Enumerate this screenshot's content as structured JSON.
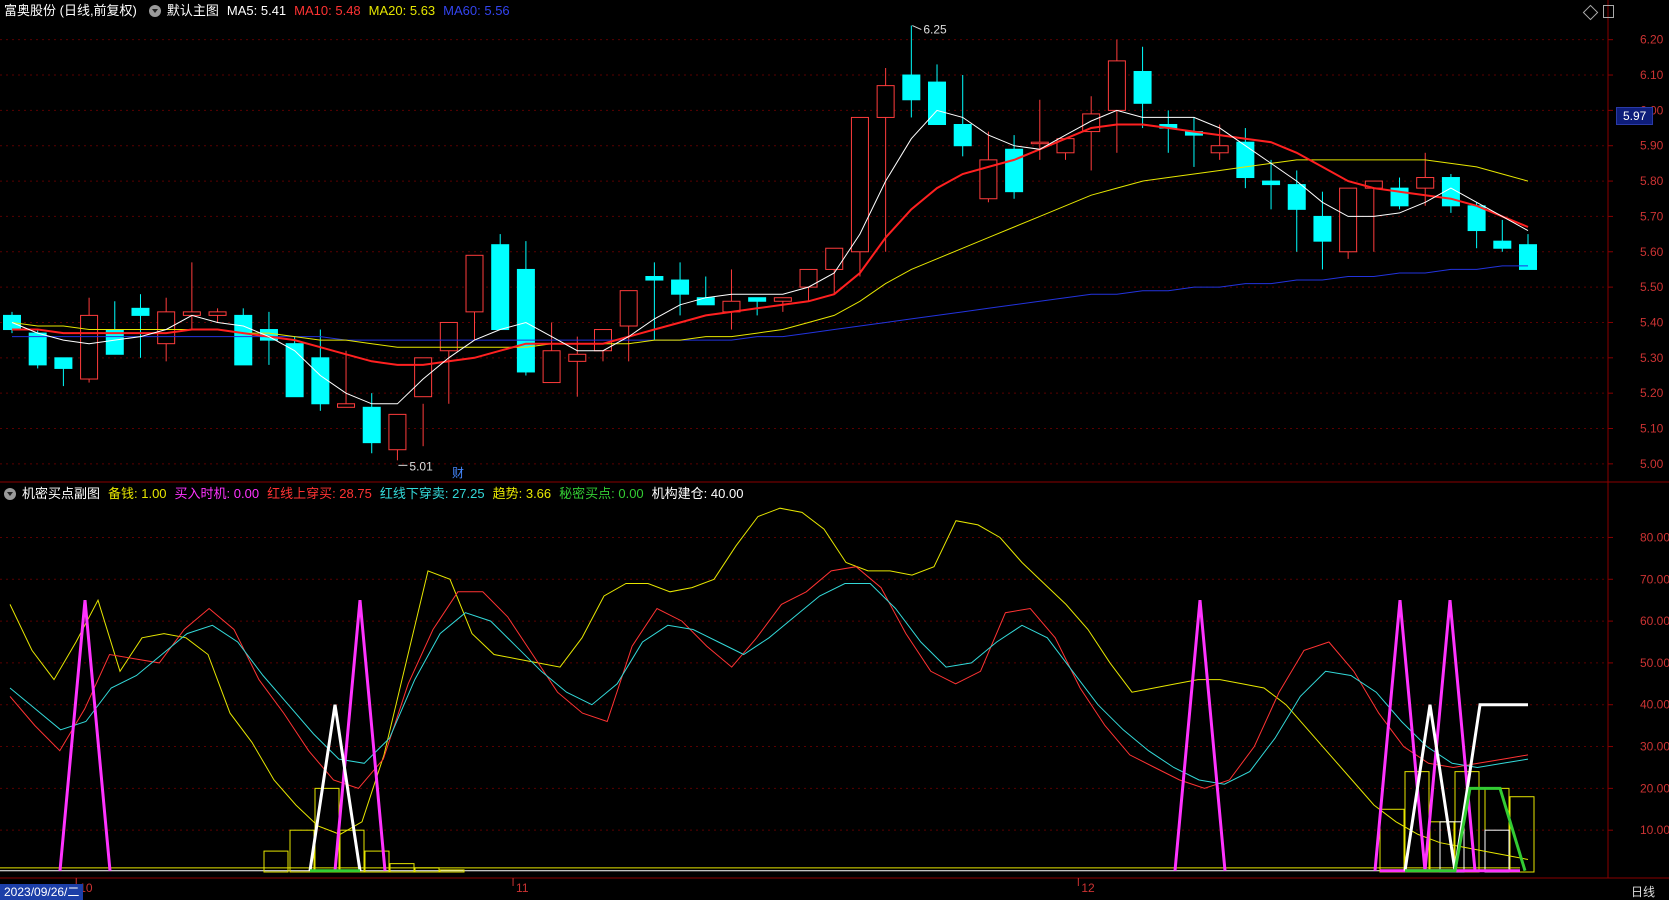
{
  "header": {
    "title": "富奥股份 (日线,前复权)",
    "main_indicator": "默认主图",
    "ma5": "MA5: 5.41",
    "ma10": "MA10: 5.48",
    "ma20": "MA20: 5.63",
    "ma60": "MA60: 5.56"
  },
  "sub_header": {
    "name": "机密买点副图",
    "items": [
      {
        "label": "备钱: 1.00",
        "color": "#e6e600"
      },
      {
        "label": "买入时机: 0.00",
        "color": "#ff33ff"
      },
      {
        "label": "红线上穿买: 28.75",
        "color": "#ff3333"
      },
      {
        "label": "红线下穿卖: 27.25",
        "color": "#33d9d9"
      },
      {
        "label": "趋势: 3.66",
        "color": "#e6e600"
      },
      {
        "label": "秘密买点: 0.00",
        "color": "#33cc33"
      },
      {
        "label": "机构建仓: 40.00",
        "color": "#ffffff"
      }
    ]
  },
  "price_axis": [
    "6.20",
    "6.10",
    "6.00",
    "5.90",
    "5.80",
    "5.70",
    "5.60",
    "5.50",
    "5.40",
    "5.30",
    "5.20",
    "5.10",
    "5.00"
  ],
  "last_price": "5.97",
  "sub_axis": [
    "80.00",
    "70.00",
    "60.00",
    "50.00",
    "40.00",
    "30.00",
    "20.00",
    "10.00"
  ],
  "high_label": "6.25",
  "low_label": "5.01",
  "finance_marker": "财",
  "month_labels": [
    {
      "label": "10",
      "date": "10-09"
    },
    {
      "label": "11",
      "date": "11-01"
    },
    {
      "label": "12",
      "date": "12-01"
    }
  ],
  "cursor_date": "2023/09/26/二",
  "period_label": "日线",
  "colors": {
    "up": "#ff3c3c",
    "down": "#00ffff",
    "ma5": "#ffffff",
    "ma10": "#ff2020",
    "ma20": "#e6e600",
    "ma60": "#2233dd",
    "grid": "#5a0000"
  },
  "chart_data": [
    {
      "type": "candlestick",
      "title": "富奥股份 (日线,前复权)",
      "ylim": [
        4.96,
        6.25
      ],
      "dates": [
        "09-26",
        "09-27",
        "09-28",
        "10-09",
        "10-10",
        "10-11",
        "10-12",
        "10-13",
        "10-16",
        "10-17",
        "10-18",
        "10-19",
        "10-20",
        "10-23",
        "10-24",
        "10-25",
        "10-26",
        "10-27",
        "10-30",
        "10-31",
        "11-01",
        "11-02",
        "11-03",
        "11-06",
        "11-07",
        "11-08",
        "11-09",
        "11-10",
        "11-13",
        "11-14",
        "11-15",
        "11-16",
        "11-17",
        "11-20",
        "11-21",
        "11-22",
        "11-23",
        "11-24",
        "11-27",
        "11-28",
        "11-29",
        "11-30",
        "12-01",
        "12-04",
        "12-05",
        "12-06",
        "12-07",
        "12-08",
        "12-11",
        "12-12",
        "12-13",
        "12-14",
        "12-15",
        "12-18",
        "12-19",
        "12-20",
        "12-21",
        "12-22",
        "12-25",
        "12-26"
      ],
      "open": [
        5.42,
        5.37,
        5.3,
        5.24,
        5.38,
        5.44,
        5.34,
        5.42,
        5.42,
        5.42,
        5.38,
        5.34,
        5.3,
        5.16,
        5.16,
        5.04,
        5.19,
        5.32,
        5.43,
        5.62,
        5.55,
        5.23,
        5.29,
        5.32,
        5.39,
        5.53,
        5.52,
        5.47,
        5.43,
        5.47,
        5.46,
        5.5,
        5.55,
        5.6,
        5.98,
        6.1,
        6.08,
        5.96,
        5.75,
        5.89,
        5.91,
        5.88,
        5.94,
        6.0,
        6.11,
        5.96,
        5.94,
        5.88,
        5.91,
        5.8,
        5.79,
        5.7,
        5.6,
        5.78,
        5.78,
        5.78,
        5.81,
        5.73,
        5.63,
        5.62
      ],
      "high": [
        5.43,
        5.38,
        5.3,
        5.47,
        5.46,
        5.48,
        5.47,
        5.57,
        5.44,
        5.44,
        5.43,
        5.36,
        5.38,
        5.32,
        5.2,
        5.06,
        5.17,
        5.34,
        5.43,
        5.65,
        5.63,
        5.4,
        5.36,
        5.35,
        5.44,
        5.57,
        5.57,
        5.53,
        5.55,
        5.47,
        5.47,
        5.54,
        5.59,
        5.63,
        6.12,
        6.24,
        6.13,
        6.1,
        5.94,
        5.93,
        6.03,
        5.91,
        6.04,
        6.2,
        6.18,
        6.0,
        5.98,
        5.96,
        5.95,
        5.86,
        5.83,
        5.77,
        5.68,
        5.8,
        5.81,
        5.88,
        5.82,
        5.74,
        5.69,
        5.65
      ],
      "low": [
        5.37,
        5.27,
        5.22,
        5.23,
        5.34,
        5.3,
        5.29,
        5.38,
        5.4,
        5.4,
        5.28,
        5.27,
        5.15,
        5.17,
        5.03,
        5.01,
        5.05,
        5.17,
        5.35,
        5.41,
        5.25,
        5.25,
        5.19,
        5.29,
        5.29,
        5.35,
        5.42,
        5.45,
        5.38,
        5.42,
        5.43,
        5.46,
        5.48,
        5.53,
        5.6,
        5.98,
        5.99,
        5.87,
        5.74,
        5.75,
        5.86,
        5.86,
        5.83,
        5.88,
        5.95,
        5.88,
        5.84,
        5.86,
        5.78,
        5.72,
        5.6,
        5.55,
        5.58,
        5.6,
        5.72,
        5.73,
        5.71,
        5.61,
        5.6,
        5.59
      ],
      "close": [
        5.38,
        5.28,
        5.27,
        5.42,
        5.31,
        5.42,
        5.43,
        5.43,
        5.43,
        5.28,
        5.35,
        5.19,
        5.17,
        5.17,
        5.06,
        5.14,
        5.3,
        5.4,
        5.59,
        5.38,
        5.26,
        5.32,
        5.31,
        5.38,
        5.49,
        5.52,
        5.48,
        5.45,
        5.46,
        5.46,
        5.47,
        5.55,
        5.61,
        5.98,
        6.07,
        6.03,
        5.96,
        5.9,
        5.86,
        5.77,
        5.91,
        5.92,
        5.99,
        6.14,
        6.02,
        5.95,
        5.93,
        5.9,
        5.81,
        5.79,
        5.72,
        5.63,
        5.78,
        5.8,
        5.73,
        5.81,
        5.73,
        5.66,
        5.61,
        5.55
      ],
      "ma": {
        "MA5": [
          5.4,
          5.37,
          5.35,
          5.34,
          5.35,
          5.36,
          5.38,
          5.42,
          5.4,
          5.39,
          5.36,
          5.32,
          5.25,
          5.2,
          5.17,
          5.17,
          5.24,
          5.3,
          5.35,
          5.38,
          5.4,
          5.36,
          5.32,
          5.32,
          5.36,
          5.41,
          5.45,
          5.47,
          5.48,
          5.48,
          5.48,
          5.5,
          5.54,
          5.65,
          5.8,
          5.92,
          6.0,
          5.98,
          5.93,
          5.9,
          5.89,
          5.93,
          5.97,
          6.0,
          5.98,
          5.98,
          5.98,
          5.95,
          5.9,
          5.85,
          5.8,
          5.74,
          5.7,
          5.7,
          5.71,
          5.74,
          5.78,
          5.74,
          5.7,
          5.66
        ],
        "MA10": [
          5.38,
          5.38,
          5.37,
          5.37,
          5.37,
          5.37,
          5.37,
          5.38,
          5.38,
          5.37,
          5.36,
          5.35,
          5.33,
          5.31,
          5.29,
          5.28,
          5.28,
          5.29,
          5.3,
          5.32,
          5.34,
          5.34,
          5.34,
          5.34,
          5.36,
          5.38,
          5.4,
          5.42,
          5.43,
          5.44,
          5.45,
          5.46,
          5.48,
          5.54,
          5.64,
          5.72,
          5.78,
          5.82,
          5.84,
          5.86,
          5.89,
          5.92,
          5.95,
          5.96,
          5.96,
          5.95,
          5.94,
          5.93,
          5.92,
          5.91,
          5.88,
          5.84,
          5.8,
          5.78,
          5.77,
          5.76,
          5.75,
          5.73,
          5.7,
          5.67
        ],
        "MA20": [
          5.4,
          5.39,
          5.39,
          5.38,
          5.38,
          5.38,
          5.38,
          5.38,
          5.38,
          5.37,
          5.37,
          5.36,
          5.35,
          5.35,
          5.34,
          5.33,
          5.33,
          5.33,
          5.33,
          5.33,
          5.33,
          5.34,
          5.34,
          5.34,
          5.34,
          5.35,
          5.35,
          5.36,
          5.36,
          5.37,
          5.38,
          5.4,
          5.42,
          5.46,
          5.51,
          5.55,
          5.58,
          5.61,
          5.64,
          5.67,
          5.7,
          5.73,
          5.76,
          5.78,
          5.8,
          5.81,
          5.82,
          5.83,
          5.84,
          5.85,
          5.86,
          5.86,
          5.86,
          5.86,
          5.86,
          5.86,
          5.85,
          5.84,
          5.82,
          5.8
        ],
        "MA60": [
          5.36,
          5.36,
          5.36,
          5.36,
          5.36,
          5.36,
          5.36,
          5.36,
          5.36,
          5.36,
          5.36,
          5.36,
          5.36,
          5.35,
          5.35,
          5.35,
          5.35,
          5.35,
          5.35,
          5.35,
          5.35,
          5.35,
          5.35,
          5.35,
          5.35,
          5.35,
          5.35,
          5.35,
          5.35,
          5.36,
          5.36,
          5.37,
          5.38,
          5.39,
          5.4,
          5.41,
          5.42,
          5.43,
          5.44,
          5.45,
          5.46,
          5.47,
          5.48,
          5.48,
          5.49,
          5.49,
          5.5,
          5.5,
          5.51,
          5.51,
          5.52,
          5.52,
          5.53,
          5.53,
          5.54,
          5.54,
          5.55,
          5.55,
          5.56,
          5.56
        ]
      }
    },
    {
      "type": "line",
      "title": "机密买点副图",
      "ylim": [
        0,
        88
      ],
      "series": [
        {
          "name": "趋势",
          "color": "#e6e600",
          "values": [
            64,
            53,
            46,
            55,
            65,
            48,
            56,
            57,
            56,
            52,
            38,
            31,
            22,
            16,
            11,
            9,
            12,
            28,
            50,
            72,
            70,
            57,
            52,
            51,
            50,
            49,
            56,
            66,
            69,
            69,
            67,
            68,
            70,
            78,
            85,
            87,
            86,
            82,
            74,
            72,
            72,
            71,
            73,
            84,
            83,
            80,
            74,
            69,
            64,
            58,
            50,
            43,
            44,
            45,
            46,
            46,
            45,
            44,
            40,
            34,
            28,
            22,
            16,
            12,
            9,
            7,
            6,
            5,
            4,
            3
          ],
          "_note": ""
        },
        {
          "name": "红线上穿买",
          "color": "#ff3333",
          "values": [
            42,
            35,
            29,
            39,
            52,
            51,
            50,
            58,
            63,
            58,
            46,
            38,
            29,
            22,
            20,
            27,
            45,
            58,
            67,
            67,
            61,
            52,
            43,
            38,
            36,
            54,
            63,
            60,
            54,
            49,
            56,
            64,
            67,
            72,
            73,
            68,
            57,
            48,
            45,
            48,
            62,
            63,
            56,
            44,
            35,
            28,
            25,
            22,
            20,
            22,
            30,
            43,
            53,
            55,
            48,
            38,
            30,
            26,
            25,
            26,
            27,
            28
          ]
        },
        {
          "name": "红线下穿卖",
          "color": "#33d9d9",
          "values": [
            44,
            39,
            34,
            36,
            44,
            47,
            52,
            57,
            59,
            55,
            47,
            40,
            33,
            27,
            26,
            32,
            46,
            57,
            62,
            60,
            54,
            48,
            43,
            40,
            45,
            55,
            59,
            58,
            55,
            52,
            56,
            61,
            66,
            69,
            69,
            63,
            55,
            49,
            50,
            55,
            59,
            56,
            48,
            40,
            34,
            29,
            25,
            22,
            21,
            24,
            32,
            42,
            48,
            47,
            43,
            36,
            30,
            26,
            25,
            26,
            27
          ]
        },
        {
          "name": "买入时机",
          "color": "#ff33ff",
          "values": [
            0,
            65,
            0,
            0,
            65,
            0,
            0,
            65,
            0,
            0,
            65,
            0,
            65,
            0
          ]
        },
        {
          "name": "机构建仓",
          "color": "#ffffff",
          "values": [
            0,
            40,
            0,
            0,
            40,
            0,
            0,
            40,
            40
          ]
        },
        {
          "name": "秘密买点",
          "color": "#33cc33",
          "values": [
            0,
            0,
            20,
            20,
            0
          ]
        },
        {
          "name": "备钱",
          "color": "#e6e600",
          "values": [
            1,
            1,
            1,
            1,
            1,
            1,
            1
          ]
        }
      ]
    }
  ]
}
